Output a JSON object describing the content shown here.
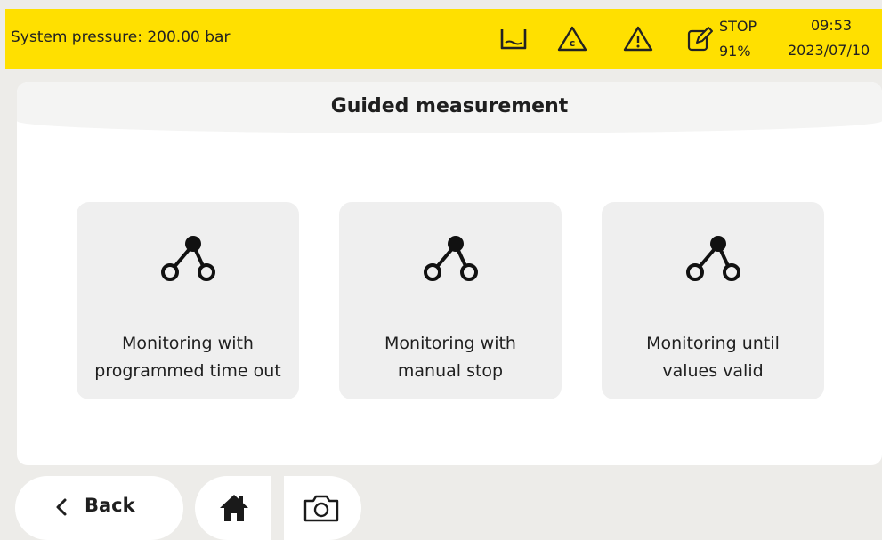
{
  "status_bar": {
    "pressure": "System pressure: 200.00 bar",
    "icons": [
      "reservoir-icon",
      "calibration-warning-icon",
      "warning-icon",
      "edit-icon"
    ],
    "stop_label": "STOP",
    "stop_percent": "91%",
    "time": "09:53",
    "date": "2023/07/10",
    "background_color": "#ffe000"
  },
  "panel": {
    "title": "Guided measurement",
    "options": [
      {
        "label": "Monitoring with\nprogrammed time out",
        "icon": "workflow-nodes-icon"
      },
      {
        "label": "Monitoring with\nmanual stop",
        "icon": "workflow-nodes-icon"
      },
      {
        "label": "Monitoring until\nvalues valid",
        "icon": "workflow-nodes-icon"
      }
    ]
  },
  "footer": {
    "back_label": "Back",
    "home_icon": "home-icon",
    "camera_icon": "camera-icon"
  }
}
